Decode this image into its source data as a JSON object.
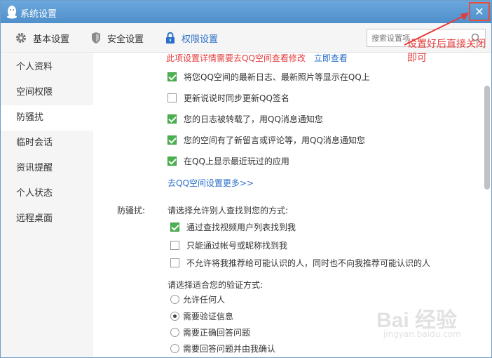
{
  "window": {
    "title": "系统设置",
    "close_glyph": "✕"
  },
  "annotation": {
    "text": "设置好后直接关闭即可",
    "color": "#e53b3b"
  },
  "toolbar": {
    "tabs": [
      {
        "label": "基本设置",
        "icon": "gear-icon",
        "active": false
      },
      {
        "label": "安全设置",
        "icon": "shield-icon",
        "active": false
      },
      {
        "label": "权限设置",
        "icon": "lock-icon",
        "active": true
      }
    ],
    "search_placeholder": "搜索设置项"
  },
  "sidebar": {
    "items": [
      {
        "label": "个人资料",
        "active": false
      },
      {
        "label": "空间权限",
        "active": false
      },
      {
        "label": "防骚扰",
        "active": true
      },
      {
        "label": "临时会话",
        "active": false
      },
      {
        "label": "资讯提醒",
        "active": false
      },
      {
        "label": "个人状态",
        "active": false
      },
      {
        "label": "远程桌面",
        "active": false
      }
    ]
  },
  "content": {
    "warning": "此项设置详情需要去QQ空间查看修改",
    "warning_link": "立即查看",
    "space_options": [
      {
        "label": "将您QQ空间的最新日志、最新照片等显示在QQ上",
        "checked": true
      },
      {
        "label": "更新说说时同步更新QQ签名",
        "checked": false
      },
      {
        "label": "您的日志被转载了，用QQ消息通知您",
        "checked": true
      },
      {
        "label": "您的空间有了新留言或评论等，用QQ消息通知您",
        "checked": true
      },
      {
        "label": "在QQ上显示最近玩过的应用",
        "checked": true
      }
    ],
    "more_link": "去QQ空间设置更多>>",
    "anti_harass": {
      "section_label": "防骚扰:",
      "find_question": "请选择允许别人查找到您的方式:",
      "find_options": [
        {
          "label": "通过查找视频用户列表找到我",
          "checked": true
        },
        {
          "label": "只能通过帐号或昵称找到我",
          "checked": false
        },
        {
          "label": "不允许将我推荐给可能认识的人，同时也不向我推荐可能认识的人",
          "checked": false
        }
      ],
      "verify_question": "请选择适合您的验证方式:",
      "verify_options": [
        {
          "label": "允许任何人",
          "selected": false
        },
        {
          "label": "需要验证信息",
          "selected": true
        },
        {
          "label": "需要正确回答问题",
          "selected": false
        },
        {
          "label": "需要回答问题并由我确认",
          "selected": false
        }
      ]
    }
  },
  "watermark": {
    "main": "Bai 经验",
    "sub": "jingyan.baidu.com"
  },
  "colors": {
    "accent": "#2a6fc9",
    "warning": "#e53b3b",
    "check_green": "#4caf50",
    "titlebar": "#5b9bd5"
  }
}
